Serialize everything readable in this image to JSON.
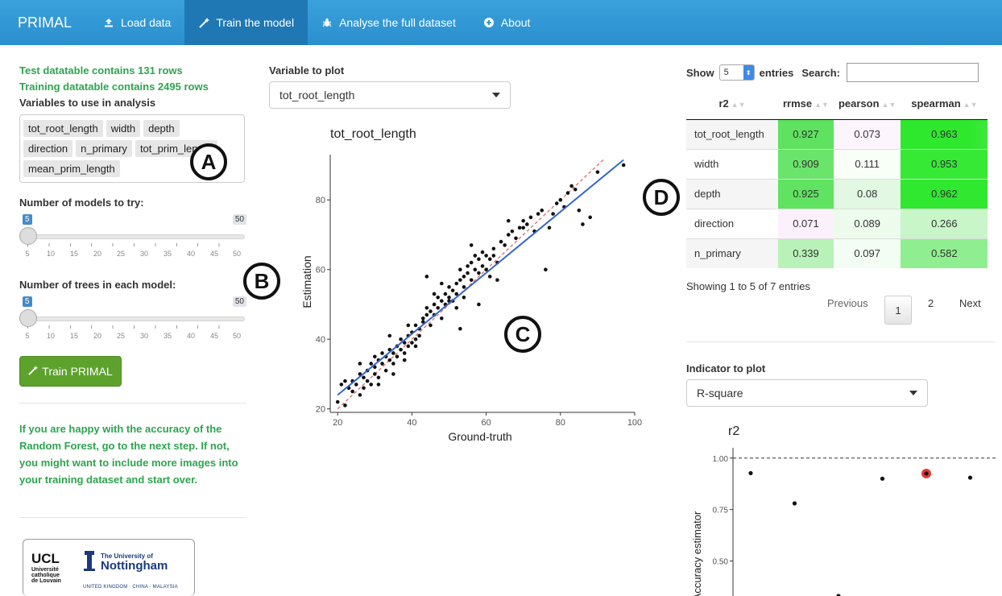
{
  "navbar": {
    "brand": "PRIMAL",
    "items": [
      {
        "label": "Load data",
        "icon": "upload-icon"
      },
      {
        "label": "Train the model",
        "icon": "magic-wand-icon"
      },
      {
        "label": "Analyse the full dataset",
        "icon": "bug-icon"
      },
      {
        "label": "About",
        "icon": "plus-circle-icon"
      }
    ],
    "active_index": 1
  },
  "left": {
    "test_info": "Test datatable contains 131 rows",
    "train_info": "Training datatable contains 2495 rows",
    "vars_label": "Variables to use in analysis",
    "variables": [
      "tot_root_length",
      "width",
      "depth",
      "direction",
      "n_primary",
      "tot_prim_length",
      "mean_prim_length"
    ],
    "models_slider": {
      "label": "Number of models to try:",
      "min_label": "5",
      "max_label": "50",
      "value": 5,
      "ticks": [
        "5",
        "10",
        "15",
        "20",
        "25",
        "30",
        "35",
        "40",
        "45",
        "50"
      ]
    },
    "trees_slider": {
      "label": "Number of trees in each model:",
      "min_label": "5",
      "max_label": "50",
      "value": 5,
      "ticks": [
        "5",
        "10",
        "15",
        "20",
        "25",
        "30",
        "35",
        "40",
        "45",
        "50"
      ]
    },
    "train_button": "Train PRIMAL",
    "advice": "If you are happy with the accuracy of the Random Forest, go to the next step. If not, you might want to include more images into your training dataset and start over.",
    "logo_ucl": "UCL",
    "logo_ucl_sub1": "Université",
    "logo_ucl_sub2": "catholique",
    "logo_ucl_sub3": "de Louvain",
    "logo_nott_top": "The University of",
    "logo_nott_name": "Nottingham",
    "logo_nott_sub": "UNITED KINGDOM · CHINA · MALAYSIA"
  },
  "annotations": {
    "a": "A",
    "b": "B",
    "c": "C",
    "d": "D"
  },
  "center": {
    "var_label": "Variable to plot",
    "var_selected": "tot_root_length"
  },
  "chart_data": [
    {
      "type": "scatter",
      "title": "tot_root_length",
      "xlabel": "Ground-truth",
      "ylabel": "Estimation",
      "xlim": [
        18,
        100
      ],
      "ylim": [
        19,
        93
      ],
      "xticks": [
        20,
        40,
        60,
        80,
        100
      ],
      "yticks": [
        20,
        40,
        60,
        80
      ],
      "fit_line": {
        "x": [
          20,
          97
        ],
        "y": [
          24,
          91.5
        ],
        "color": "#3366cc"
      },
      "identity_line": {
        "color": "#e0605a"
      },
      "points": [
        [
          20,
          22
        ],
        [
          21,
          27
        ],
        [
          22,
          21
        ],
        [
          23,
          26
        ],
        [
          24,
          25
        ],
        [
          24,
          28
        ],
        [
          25,
          27
        ],
        [
          26,
          30
        ],
        [
          26,
          33
        ],
        [
          27,
          29
        ],
        [
          27,
          26
        ],
        [
          28,
          28
        ],
        [
          28,
          31
        ],
        [
          29,
          33
        ],
        [
          29,
          27
        ],
        [
          30,
          32
        ],
        [
          30,
          35
        ],
        [
          30,
          30
        ],
        [
          31,
          34
        ],
        [
          31,
          29
        ],
        [
          32,
          33
        ],
        [
          32,
          36
        ],
        [
          33,
          31
        ],
        [
          33,
          35
        ],
        [
          34,
          34
        ],
        [
          34,
          37
        ],
        [
          35,
          33
        ],
        [
          35,
          36
        ],
        [
          36,
          38
        ],
        [
          36,
          35
        ],
        [
          37,
          37
        ],
        [
          37,
          40
        ],
        [
          38,
          39
        ],
        [
          38,
          36
        ],
        [
          38,
          34
        ],
        [
          39,
          41
        ],
        [
          39,
          38
        ],
        [
          40,
          42
        ],
        [
          40,
          39
        ],
        [
          41,
          40
        ],
        [
          41,
          44
        ],
        [
          42,
          43
        ],
        [
          42,
          41
        ],
        [
          43,
          46
        ],
        [
          43,
          45
        ],
        [
          44,
          47
        ],
        [
          44,
          49
        ],
        [
          45,
          44
        ],
        [
          45,
          48
        ],
        [
          46,
          50
        ],
        [
          46,
          47
        ],
        [
          47,
          49
        ],
        [
          47,
          52
        ],
        [
          48,
          51
        ],
        [
          48,
          46
        ],
        [
          49,
          53
        ],
        [
          49,
          50
        ],
        [
          50,
          52
        ],
        [
          50,
          55
        ],
        [
          51,
          54
        ],
        [
          51,
          51
        ],
        [
          52,
          56
        ],
        [
          52,
          53
        ],
        [
          52,
          49
        ],
        [
          53,
          57
        ],
        [
          53,
          60
        ],
        [
          54,
          55
        ],
        [
          54,
          58
        ],
        [
          55,
          59
        ],
        [
          55,
          61
        ],
        [
          56,
          57
        ],
        [
          56,
          62
        ],
        [
          57,
          64
        ],
        [
          57,
          60
        ],
        [
          58,
          63
        ],
        [
          58,
          59
        ],
        [
          59,
          61
        ],
        [
          59,
          65
        ],
        [
          60,
          60
        ],
        [
          60,
          64
        ],
        [
          61,
          63
        ],
        [
          61,
          58
        ],
        [
          62,
          66
        ],
        [
          63,
          62
        ],
        [
          64,
          68
        ],
        [
          65,
          67
        ],
        [
          66,
          70
        ],
        [
          67,
          71
        ],
        [
          68,
          69
        ],
        [
          69,
          72
        ],
        [
          70,
          74
        ],
        [
          71,
          73
        ],
        [
          72,
          75
        ],
        [
          73,
          71
        ],
        [
          74,
          76
        ],
        [
          75,
          77
        ],
        [
          76,
          60
        ],
        [
          77,
          72
        ],
        [
          78,
          76
        ],
        [
          79,
          79
        ],
        [
          80,
          80
        ],
        [
          81,
          78
        ],
        [
          82,
          82
        ],
        [
          84,
          83
        ],
        [
          85,
          77
        ],
        [
          86,
          73
        ],
        [
          88,
          75
        ],
        [
          90,
          88
        ],
        [
          97,
          90
        ],
        [
          22,
          28
        ],
        [
          34,
          41
        ],
        [
          41,
          38
        ],
        [
          44,
          58
        ],
        [
          48,
          56
        ],
        [
          50,
          51
        ],
        [
          56,
          67
        ],
        [
          62,
          64
        ],
        [
          53,
          43
        ],
        [
          35,
          30
        ],
        [
          66,
          74
        ],
        [
          70,
          72
        ],
        [
          26,
          24
        ],
        [
          46,
          53
        ],
        [
          58,
          50
        ],
        [
          39,
          44
        ],
        [
          31,
          27
        ],
        [
          83,
          84
        ],
        [
          63,
          57
        ],
        [
          54,
          52
        ]
      ]
    },
    {
      "type": "scatter",
      "title": "r2",
      "xlabel": "",
      "ylabel": "Accuracy estimator",
      "ylim": [
        0.33,
        1.05
      ],
      "yticks": [
        0.5,
        0.75,
        1.0
      ],
      "reference_line": 1.0,
      "points": [
        {
          "x": 1,
          "y": 0.927
        },
        {
          "x": 2,
          "y": 0.78
        },
        {
          "x": 3,
          "y": 0.33
        },
        {
          "x": 4,
          "y": 0.9
        },
        {
          "x": 5,
          "y": 0.925,
          "highlight": true
        },
        {
          "x": 6,
          "y": 0.905
        }
      ],
      "highlight_color": "#e53935"
    }
  ],
  "datatable": {
    "show_label": "Show",
    "length_value": "5",
    "entries_label": "entries",
    "search_label": "Search:",
    "columns": [
      "r2",
      "rrmse",
      "pearson",
      "spearman"
    ],
    "rows": [
      {
        "name": "tot_root_length",
        "r2": "0.927",
        "rrmse": "0.073",
        "pearson": "0.963",
        "r2_color": "#5fe25f",
        "rrmse_color": "#fdf5fd",
        "pearson_color": "#2ee82e"
      },
      {
        "name": "width",
        "r2": "0.909",
        "rrmse": "0.111",
        "pearson": "0.953",
        "r2_color": "#6ae46a",
        "rrmse_color": "#f7fff7",
        "pearson_color": "#35e935"
      },
      {
        "name": "depth",
        "r2": "0.925",
        "rrmse": "0.08",
        "pearson": "0.962",
        "r2_color": "#60e360",
        "rrmse_color": "#e2f8e2",
        "pearson_color": "#2fe82f"
      },
      {
        "name": "direction",
        "r2": "0.071",
        "rrmse": "0.089",
        "pearson": "0.266",
        "r2_color": "#fdf0fd",
        "rrmse_color": "#ecfbec",
        "pearson_color": "#c8f6c8"
      },
      {
        "name": "n_primary",
        "r2": "0.339",
        "rrmse": "0.097",
        "pearson": "0.582",
        "r2_color": "#b8f2b8",
        "rrmse_color": "#f3fdf3",
        "pearson_color": "#8fee8f"
      }
    ],
    "info": "Showing 1 to 5 of 7 entries",
    "prev": "Previous",
    "pages": [
      "1",
      "2"
    ],
    "next": "Next"
  },
  "indicator": {
    "label": "Indicator to plot",
    "selected": "R-square"
  }
}
